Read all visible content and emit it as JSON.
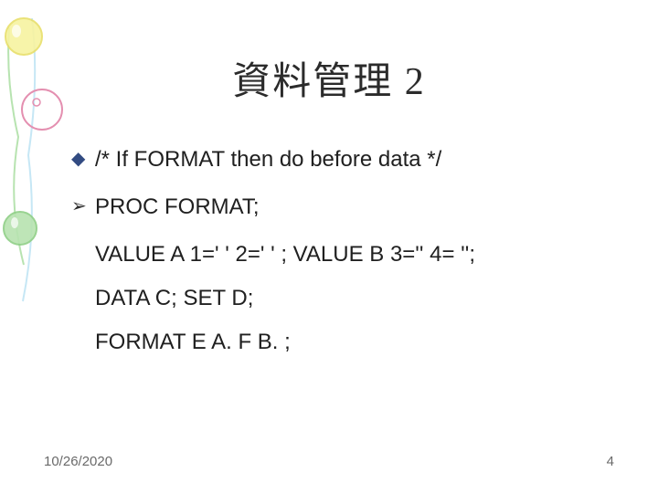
{
  "title": "資料管理 2",
  "bullets": {
    "b1": "/*  If   FORMAT then do before data  */",
    "b2": "PROC FORMAT;",
    "b3": "VALUE A   1=' '   2=' ' ;      VALUE B 3='' 4= '';",
    "b4": "DATA   C;               SET D;",
    "b5": "FORMAT     E A.      F B.  ;"
  },
  "footer": {
    "date": "10/26/2020",
    "page": "4"
  }
}
